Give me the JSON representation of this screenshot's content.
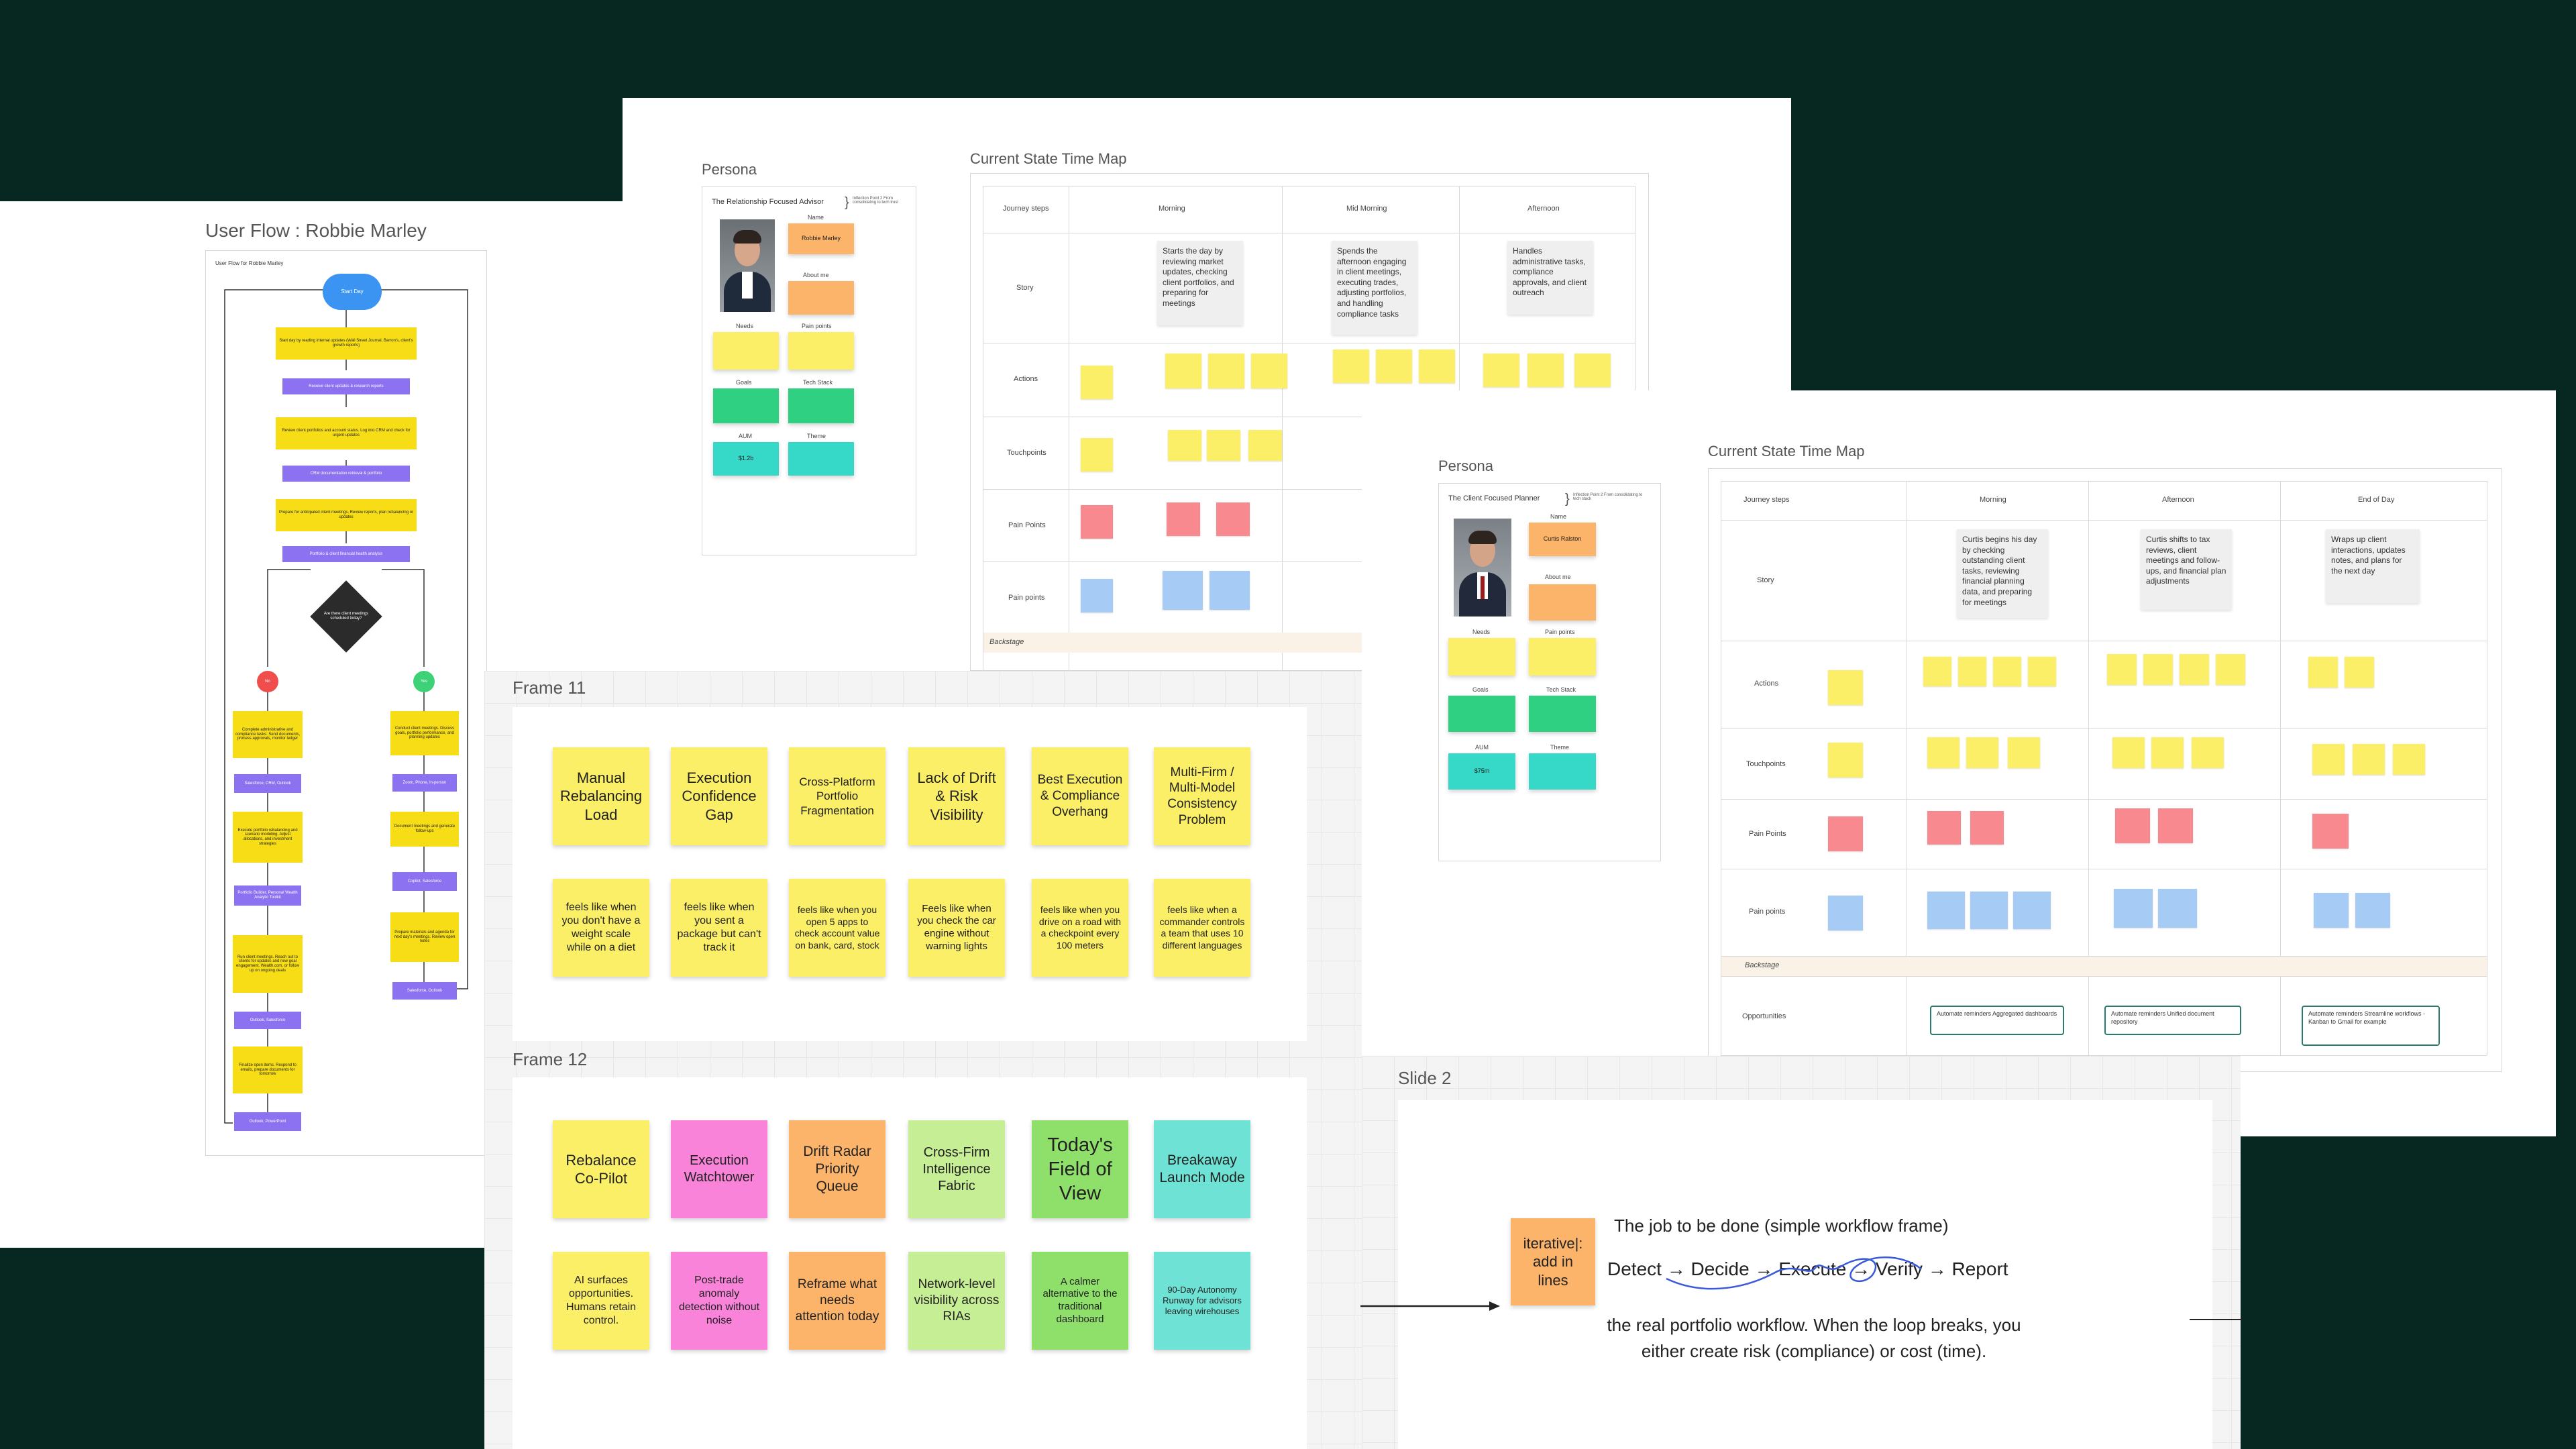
{
  "user_flow": {
    "title": "User Flow : Robbie Marley",
    "inner_label": "User Flow for Robbie Marley",
    "start_label": "Start Day",
    "steps": [
      "Start day by reading internal updates (Wall Street Journal, Barron's, client's growth reports)",
      "Receive client updates & research reports",
      "Review client portfolios and account status. Log into CRM and check for urgent updates",
      "CRM documentation retrieval & portfolio",
      "Prepare for anticipated client meetings. Review reports, plan rebalancing or updates",
      "Portfolio & client financial health analysis"
    ],
    "decision": "Are there client meetings scheduled today?",
    "no_label": "No",
    "yes_label": "Yes",
    "left_steps": [
      "Complete administrative and compliance tasks: Send documents, process approvals, monitor ledger",
      "Salesforce, CRM, Outlook",
      "Execute portfolio rebalancing and scenario modeling. Adjust allocations, and investment strategies",
      "Portfolio Builder, Personal Wealth Analytic Toolkit",
      "Run client meetings. Reach out to clients for updates and new goal engagement. Wealth.com, or follow up on ongoing deals",
      "Outlook, Salesforce",
      "Finalize open items. Respond to emails, prepare documents for tomorrow",
      "Outlook, PowerPoint"
    ],
    "right_steps": [
      "Conduct client meetings. Discuss goals, portfolio performance, and planning updates",
      "Zoom, Phone, In-person",
      "Document meetings and generate follow-ups",
      "Copilot, Salesforce",
      "Prepare materials and agenda for next day's meetings. Review open notes",
      "Salesforce, Outlook"
    ]
  },
  "persona_1": {
    "title": "Persona",
    "card_title": "The Relationship Focused Advisor",
    "annotation": "Inflection Point 2 From consolidating to tech trust",
    "name_label": "Name",
    "name_value": "Robbie Marley",
    "about_label": "About me",
    "needs_label": "Needs",
    "pain_label": "Pain points",
    "goals_label": "Goals",
    "tech_label": "Tech Stack",
    "aum_label": "AUM",
    "aum_value": "$1.2b",
    "theme_label": "Theme"
  },
  "time_map_1": {
    "title": "Current State Time Map",
    "header": [
      "Journey steps",
      "Morning",
      "Mid Morning",
      "Afternoon"
    ],
    "rows": [
      "Story",
      "Actions",
      "Touchpoints",
      "Pain Points",
      "Pain points",
      "Backstage"
    ],
    "stories": [
      "Starts the day by reviewing market updates, checking client portfolios, and preparing for meetings",
      "Spends the afternoon engaging in client meetings, executing trades, adjusting portfolios, and handling compliance tasks",
      "Handles administrative tasks, compliance approvals, and client outreach"
    ]
  },
  "persona_2": {
    "title": "Persona",
    "card_title": "The Client Focused Planner",
    "annotation": "Inflection Point 2 From consolidating to tech stack",
    "name_label": "Name",
    "name_value": "Curtis Ralston",
    "about_label": "About me",
    "needs_label": "Needs",
    "pain_label": "Pain points",
    "goals_label": "Goals",
    "tech_label": "Tech Stack",
    "aum_label": "AUM",
    "aum_value": "$75m",
    "theme_label": "Theme"
  },
  "time_map_2": {
    "title": "Current State Time Map",
    "header": [
      "Journey steps",
      "Morning",
      "Afternoon",
      "End of Day"
    ],
    "rows": [
      "Story",
      "Actions",
      "Touchpoints",
      "Pain Points",
      "Pain points",
      "Backstage",
      "Opportunities"
    ],
    "stories": [
      "Curtis begins his day by checking outstanding client tasks, reviewing financial planning data, and preparing for meetings",
      "Curtis shifts to tax reviews, client meetings and follow-ups, and financial plan adjustments",
      "Wraps up client interactions, updates notes, and plans for the next day"
    ],
    "opportunities": [
      "Automate reminders Aggregated dashboards",
      "Automate reminders Unified document repository",
      "Automate reminders Streamline workflows - Kanban to Gmail for example"
    ]
  },
  "frame_11": {
    "title": "Frame 11",
    "top": [
      "Manual Rebalancing Load",
      "Execution Confidence Gap",
      "Cross-Platform Portfolio Fragmentation",
      "Lack of Drift & Risk Visibility",
      "Best Execution & Compliance Overhang",
      "Multi-Firm / Multi-Model Consistency Problem"
    ],
    "bottom": [
      "feels like when you don't have a weight scale while on a diet",
      "feels like when you sent a package but can't track it",
      "feels like when you open 5 apps to check account value on bank, card, stock",
      "Feels like when you check the car engine without warning lights",
      "feels like when you drive on a road with a checkpoint every 100 meters",
      "feels like when a commander controls a team that uses 10 different languages"
    ]
  },
  "frame_12": {
    "title": "Frame 12",
    "top": [
      "Rebalance Co-Pilot",
      "Execution Watchtower",
      "Drift Radar Priority Queue",
      "Cross-Firm Intelligence Fabric",
      "Today's Field of View",
      "Breakaway Launch Mode"
    ],
    "bottom": [
      "AI surfaces opportunities. Humans retain control.",
      "Post-trade anomaly detection without noise",
      "Reframe what needs attention today",
      "Network-level visibility across RIAs",
      "A calmer alternative to the traditional dashboard",
      "90-Day Autonomy Runway for advisors leaving wirehouses"
    ]
  },
  "slide_2": {
    "title": "Slide 2",
    "sticky": "iterative|: add in lines",
    "heading": "The job to be done (simple workflow frame)",
    "workflow": "Detect → Decide → Execute → Verify → Report",
    "body": "the real portfolio workflow. When the loop breaks, you either create risk (compliance) or cost (time)."
  },
  "colors": {
    "background": "#062821",
    "sticky_yellow": "#fbef67",
    "sticky_orange": "#fbb46a",
    "sticky_pink": "#f883d9",
    "sticky_green": "#c6ee95",
    "sticky_lime": "#8ee06b",
    "sticky_teal": "#6ee2d4",
    "flow_blue": "#3c94f2",
    "flow_purple": "#8c72f0",
    "flow_yellow": "#f7dd16"
  }
}
